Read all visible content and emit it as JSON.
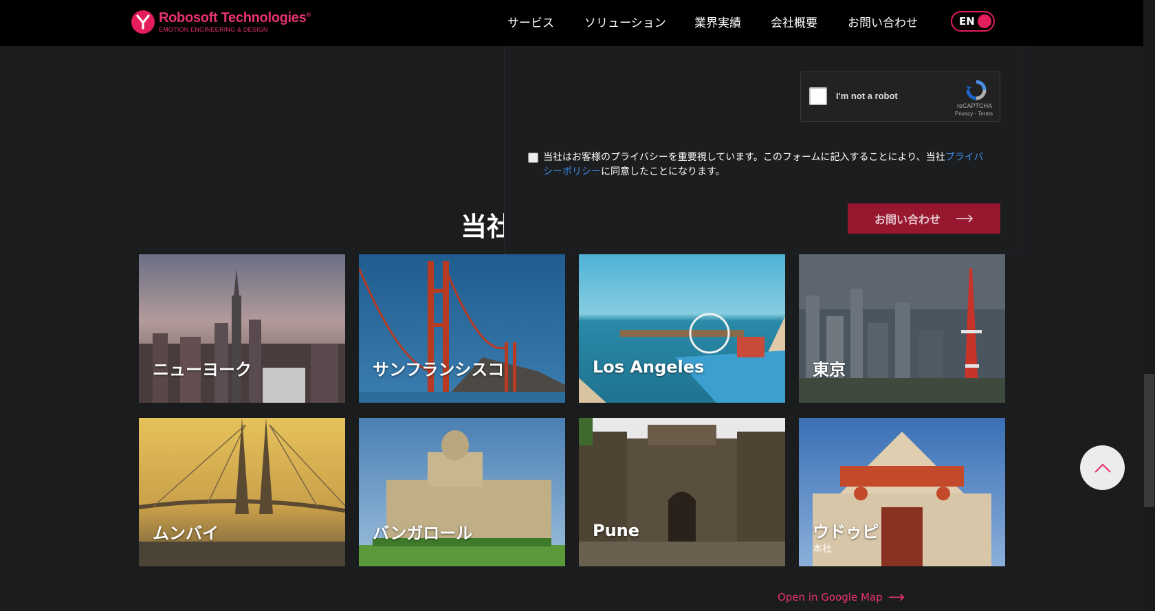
{
  "header": {
    "logo_name": "Robosoft Technologies",
    "logo_reg": "®",
    "logo_tagline": "EMOTION ENGINEERING & DESIGN",
    "nav": [
      "サービス",
      "ソリューション",
      "業界実績",
      "会社概要",
      "お問い合わせ"
    ],
    "lang": "EN",
    "brand_color": "#e31e5a"
  },
  "form": {
    "recaptcha_label": "I'm not a robot",
    "recaptcha_brand": "reCAPTCHA",
    "recaptcha_links": "Privacy - Terms",
    "privacy_text_1": "当社はお客様のプライバシーを重要視しています。このフォームに記入することにより、当社",
    "privacy_link": "プライバシーポリシー",
    "privacy_text_2": "に同意したことになります。",
    "submit_label": "お問い合わせ",
    "submit_color": "#97172f"
  },
  "offices": {
    "title": "当社",
    "tiles": [
      {
        "name": "ニューヨーク",
        "sub": ""
      },
      {
        "name": "サンフランシスコ",
        "sub": ""
      },
      {
        "name": "Los Angeles",
        "sub": ""
      },
      {
        "name": "東京",
        "sub": ""
      },
      {
        "name": "ムンバイ",
        "sub": ""
      },
      {
        "name": "バンガロール",
        "sub": ""
      },
      {
        "name": "Pune",
        "sub": ""
      },
      {
        "name": "ウドゥピ",
        "sub": "本社"
      }
    ],
    "map_link": "Open in Google Map"
  }
}
